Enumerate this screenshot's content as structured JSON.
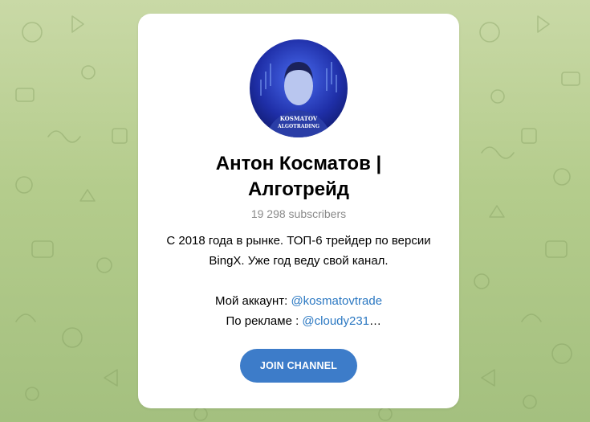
{
  "channel": {
    "name": "Антон Косматов | Алготрейд",
    "name_line1": "Антон Косматов |",
    "name_line2": "Алготрейд",
    "subscribers": "19 298 subscribers",
    "avatar_text_line1": "KOSMATOV",
    "avatar_text_line2": "ALGOTRADING",
    "description": {
      "line1": "С 2018 года в рынке. ТОП-6 трейдер по версии",
      "line2": "BingX. Уже год веду свой канал.",
      "account_label": "Мой аккаунт: ",
      "account_link": "@kosmatovtrade",
      "ads_label": "По рекламе : ",
      "ads_link": "@cloudy231",
      "ads_ellipsis": "…"
    }
  },
  "actions": {
    "join_label": "JOIN CHANNEL"
  },
  "colors": {
    "accent": "#3d7cc9",
    "link": "#2b78c2",
    "background": "#b4cc8c"
  }
}
